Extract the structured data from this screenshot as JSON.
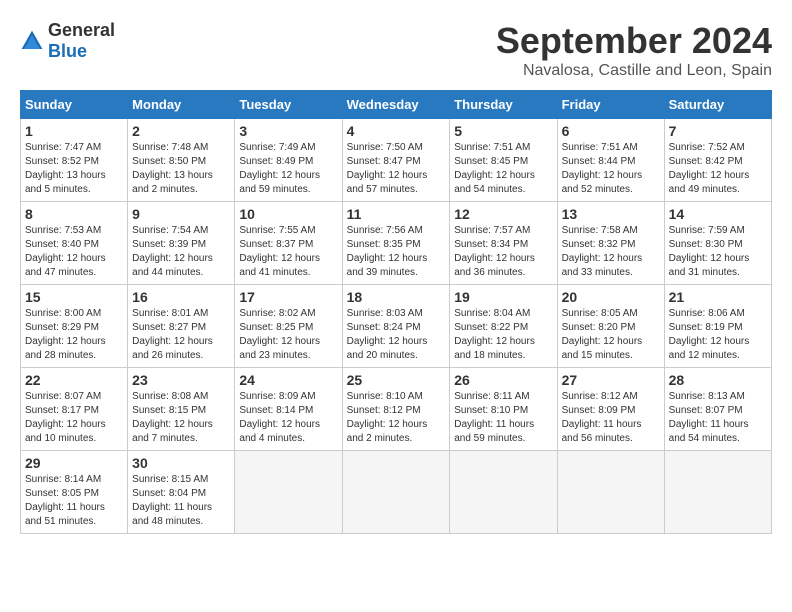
{
  "logo": {
    "general": "General",
    "blue": "Blue"
  },
  "title": "September 2024",
  "location": "Navalosa, Castille and Leon, Spain",
  "days_header": [
    "Sunday",
    "Monday",
    "Tuesday",
    "Wednesday",
    "Thursday",
    "Friday",
    "Saturday"
  ],
  "weeks": [
    {
      "shaded": false,
      "days": [
        {
          "num": "1",
          "info": "Sunrise: 7:47 AM\nSunset: 8:52 PM\nDaylight: 13 hours\nand 5 minutes."
        },
        {
          "num": "2",
          "info": "Sunrise: 7:48 AM\nSunset: 8:50 PM\nDaylight: 13 hours\nand 2 minutes."
        },
        {
          "num": "3",
          "info": "Sunrise: 7:49 AM\nSunset: 8:49 PM\nDaylight: 12 hours\nand 59 minutes."
        },
        {
          "num": "4",
          "info": "Sunrise: 7:50 AM\nSunset: 8:47 PM\nDaylight: 12 hours\nand 57 minutes."
        },
        {
          "num": "5",
          "info": "Sunrise: 7:51 AM\nSunset: 8:45 PM\nDaylight: 12 hours\nand 54 minutes."
        },
        {
          "num": "6",
          "info": "Sunrise: 7:51 AM\nSunset: 8:44 PM\nDaylight: 12 hours\nand 52 minutes."
        },
        {
          "num": "7",
          "info": "Sunrise: 7:52 AM\nSunset: 8:42 PM\nDaylight: 12 hours\nand 49 minutes."
        }
      ]
    },
    {
      "shaded": true,
      "days": [
        {
          "num": "8",
          "info": "Sunrise: 7:53 AM\nSunset: 8:40 PM\nDaylight: 12 hours\nand 47 minutes."
        },
        {
          "num": "9",
          "info": "Sunrise: 7:54 AM\nSunset: 8:39 PM\nDaylight: 12 hours\nand 44 minutes."
        },
        {
          "num": "10",
          "info": "Sunrise: 7:55 AM\nSunset: 8:37 PM\nDaylight: 12 hours\nand 41 minutes."
        },
        {
          "num": "11",
          "info": "Sunrise: 7:56 AM\nSunset: 8:35 PM\nDaylight: 12 hours\nand 39 minutes."
        },
        {
          "num": "12",
          "info": "Sunrise: 7:57 AM\nSunset: 8:34 PM\nDaylight: 12 hours\nand 36 minutes."
        },
        {
          "num": "13",
          "info": "Sunrise: 7:58 AM\nSunset: 8:32 PM\nDaylight: 12 hours\nand 33 minutes."
        },
        {
          "num": "14",
          "info": "Sunrise: 7:59 AM\nSunset: 8:30 PM\nDaylight: 12 hours\nand 31 minutes."
        }
      ]
    },
    {
      "shaded": false,
      "days": [
        {
          "num": "15",
          "info": "Sunrise: 8:00 AM\nSunset: 8:29 PM\nDaylight: 12 hours\nand 28 minutes."
        },
        {
          "num": "16",
          "info": "Sunrise: 8:01 AM\nSunset: 8:27 PM\nDaylight: 12 hours\nand 26 minutes."
        },
        {
          "num": "17",
          "info": "Sunrise: 8:02 AM\nSunset: 8:25 PM\nDaylight: 12 hours\nand 23 minutes."
        },
        {
          "num": "18",
          "info": "Sunrise: 8:03 AM\nSunset: 8:24 PM\nDaylight: 12 hours\nand 20 minutes."
        },
        {
          "num": "19",
          "info": "Sunrise: 8:04 AM\nSunset: 8:22 PM\nDaylight: 12 hours\nand 18 minutes."
        },
        {
          "num": "20",
          "info": "Sunrise: 8:05 AM\nSunset: 8:20 PM\nDaylight: 12 hours\nand 15 minutes."
        },
        {
          "num": "21",
          "info": "Sunrise: 8:06 AM\nSunset: 8:19 PM\nDaylight: 12 hours\nand 12 minutes."
        }
      ]
    },
    {
      "shaded": true,
      "days": [
        {
          "num": "22",
          "info": "Sunrise: 8:07 AM\nSunset: 8:17 PM\nDaylight: 12 hours\nand 10 minutes."
        },
        {
          "num": "23",
          "info": "Sunrise: 8:08 AM\nSunset: 8:15 PM\nDaylight: 12 hours\nand 7 minutes."
        },
        {
          "num": "24",
          "info": "Sunrise: 8:09 AM\nSunset: 8:14 PM\nDaylight: 12 hours\nand 4 minutes."
        },
        {
          "num": "25",
          "info": "Sunrise: 8:10 AM\nSunset: 8:12 PM\nDaylight: 12 hours\nand 2 minutes."
        },
        {
          "num": "26",
          "info": "Sunrise: 8:11 AM\nSunset: 8:10 PM\nDaylight: 11 hours\nand 59 minutes."
        },
        {
          "num": "27",
          "info": "Sunrise: 8:12 AM\nSunset: 8:09 PM\nDaylight: 11 hours\nand 56 minutes."
        },
        {
          "num": "28",
          "info": "Sunrise: 8:13 AM\nSunset: 8:07 PM\nDaylight: 11 hours\nand 54 minutes."
        }
      ]
    },
    {
      "shaded": false,
      "days": [
        {
          "num": "29",
          "info": "Sunrise: 8:14 AM\nSunset: 8:05 PM\nDaylight: 11 hours\nand 51 minutes."
        },
        {
          "num": "30",
          "info": "Sunrise: 8:15 AM\nSunset: 8:04 PM\nDaylight: 11 hours\nand 48 minutes."
        },
        null,
        null,
        null,
        null,
        null
      ]
    }
  ]
}
